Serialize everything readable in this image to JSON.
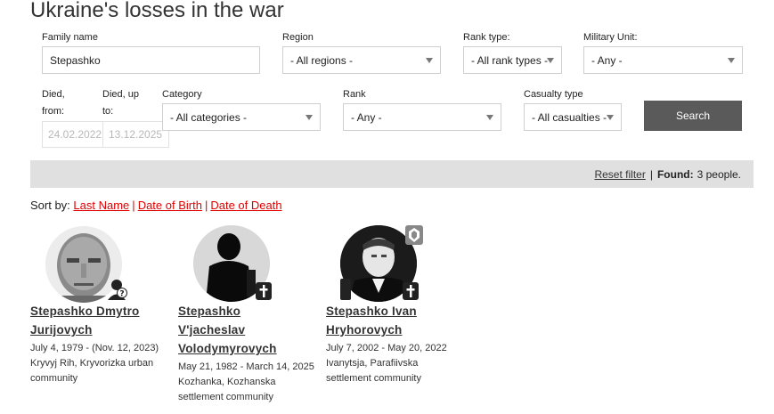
{
  "page": {
    "title": "Ukraine's losses in the war"
  },
  "filters": {
    "family_name": {
      "label": "Family name",
      "value": "Stepashko"
    },
    "region": {
      "label": "Region",
      "value": "- All regions -"
    },
    "rank_type": {
      "label": "Rank type:",
      "value": "- All rank types -"
    },
    "military_unit": {
      "label": "Military Unit:",
      "value": "- Any -"
    },
    "died_from": {
      "label_line1": "Died,",
      "label_line2": "from:",
      "value": "24.02.2022"
    },
    "died_to": {
      "label_line1": "Died, up",
      "label_line2": "to:",
      "value": "13.12.2025"
    },
    "category": {
      "label": "Category",
      "value": "- All categories -"
    },
    "rank": {
      "label": "Rank",
      "value": "- Any -"
    },
    "casualty_type": {
      "label": "Casualty type",
      "value": "- All casualties -"
    },
    "search_label": "Search"
  },
  "results": {
    "reset_label": "Reset filter",
    "separator": "|",
    "found_label": "Found:",
    "found_value": "3 people."
  },
  "sort": {
    "label": "Sort by:",
    "options": [
      "Last Name",
      "Date of Birth",
      "Date of Death"
    ],
    "pipe": "|"
  },
  "people": [
    {
      "name_lines": [
        "Stepashko Dmytro",
        "Jurijovych"
      ],
      "dates": "July 4, 1979 - (Nov. 12, 2023)",
      "place_lines": [
        "Kryvyj Rih, Kryvorizka urban",
        "community"
      ],
      "status_icon": "missing-person-icon"
    },
    {
      "name_lines": [
        "Stepashko",
        "V'jacheslav",
        "Volodymyrovych"
      ],
      "dates": "May 21, 1982 - March 14, 2025",
      "place_lines": [
        "Kozhanka, Kozhanska",
        "settlement community"
      ],
      "status_icon": "memorial-cross-icon"
    },
    {
      "name_lines": [
        "Stepashko Ivan",
        "Hryhorovych"
      ],
      "dates": "July 7, 2002 - May 20, 2022",
      "place_lines": [
        "Ivanytsja, Parafiivska",
        "settlement community"
      ],
      "status_icon": "memorial-cross-icon",
      "award_icon": "award-badge-icon"
    }
  ]
}
